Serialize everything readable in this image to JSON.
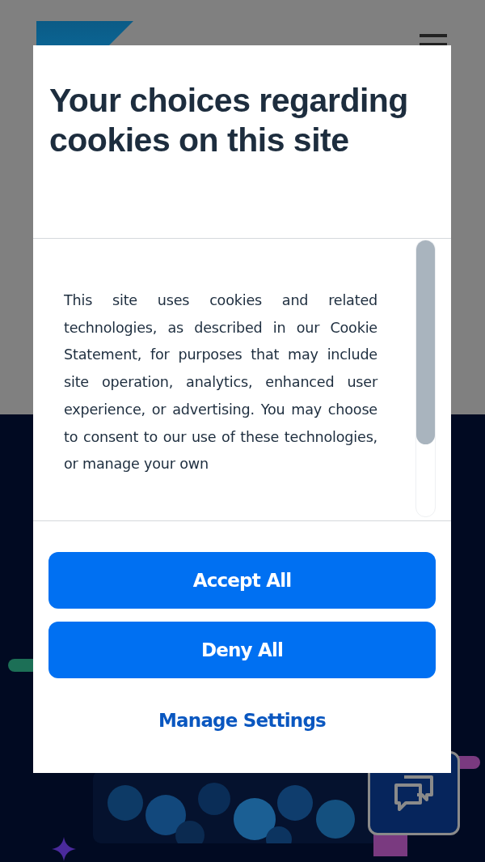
{
  "dialog": {
    "title": "Your choices regarding cookies on this site",
    "body": "This site uses cookies and related technologies, as described in our Cookie Statement, for purposes that may include site operation, analytics, enhanced user experience, or advertising. You may choose to consent to our use of these technologies, or manage your own",
    "buttons": [
      {
        "label": "Accept All",
        "kind": "primary"
      },
      {
        "label": "Deny All",
        "kind": "primary"
      },
      {
        "label": "Manage Settings",
        "kind": "link"
      }
    ]
  }
}
